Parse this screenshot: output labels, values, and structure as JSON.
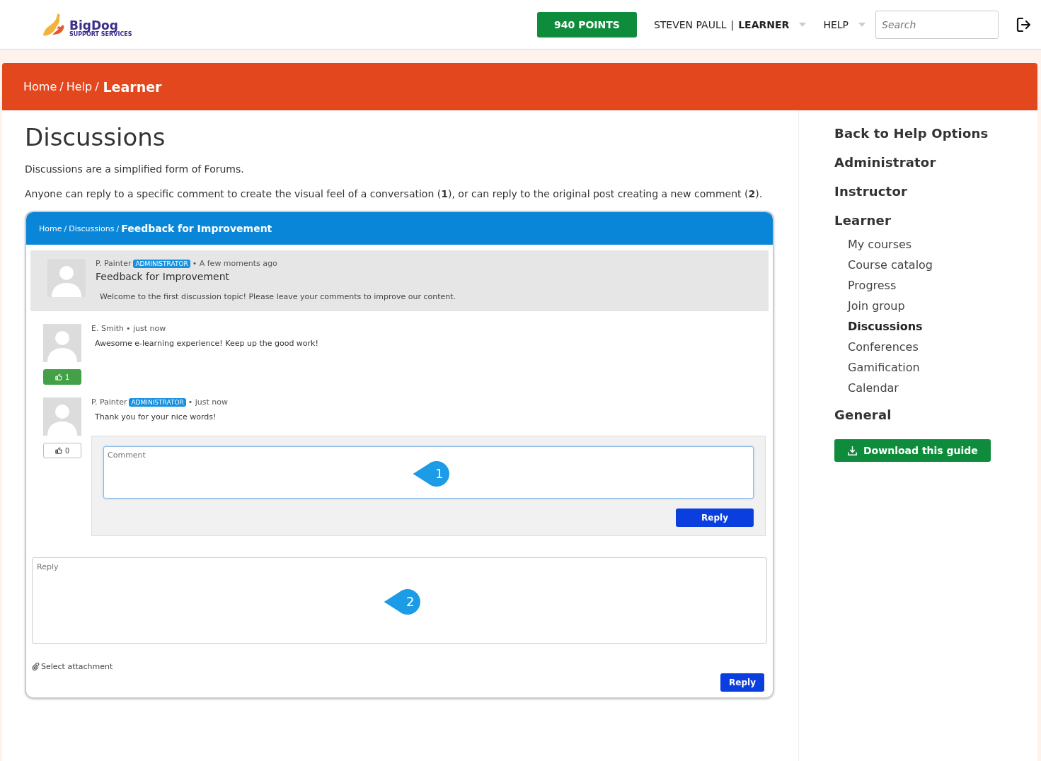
{
  "header": {
    "logo": {
      "name": "BigDog",
      "tagline": "SUPPORT SERVICES"
    },
    "points": "940 POINTS",
    "user": {
      "name": "STEVEN PAULL",
      "separator": "|",
      "role": "LEARNER"
    },
    "help": "HELP",
    "search": {
      "placeholder": "Search"
    }
  },
  "breadcrumb": {
    "separator": "/",
    "items": [
      "Home",
      "Help"
    ],
    "current": "Learner"
  },
  "main": {
    "title": "Discussions",
    "paragraphs": [
      "Discussions are a simplified form of Forums.",
      "Anyone can reply to a specific comment to create the visual feel of a conversation (**1**), or can reply to the original post creating a new comment (**2**)."
    ],
    "screenshot": {
      "breadcrumb": {
        "separator": "/",
        "items": [
          "Home",
          "Discussions"
        ],
        "current": "Feedback for Improvement"
      },
      "post": {
        "author": "P. Painter",
        "badge": "ADMINISTRATOR",
        "time": "• A few moments ago",
        "title": "Feedback for Improvement",
        "body": "Welcome to the first discussion topic! Please leave your comments to improve our content."
      },
      "comments": [
        {
          "author": "E. Smith",
          "time": "• just now",
          "body": "Awesome e-learning experience! Keep up the good work!",
          "likes": "1",
          "liked": true
        },
        {
          "author": "P. Painter",
          "badge": "ADMINISTRATOR",
          "time": "• just now",
          "body": "Thank you for your nice words!",
          "likes": "0",
          "liked": false,
          "reply_box": {
            "placeholder": "Comment",
            "marker": "1",
            "button": "Reply"
          }
        }
      ],
      "reply_field": {
        "placeholder": "Reply",
        "marker": "2"
      },
      "attachment": "Select attachment",
      "reply_button": "Reply"
    }
  },
  "sidebar": {
    "items": [
      {
        "label": "Back to Help Options",
        "selected": false
      },
      {
        "label": "Administrator",
        "selected": false
      },
      {
        "label": "Instructor",
        "selected": false
      },
      {
        "label": "Learner",
        "selected": false,
        "children": [
          {
            "label": "My courses",
            "selected": false
          },
          {
            "label": "Course catalog",
            "selected": false
          },
          {
            "label": "Progress",
            "selected": false
          },
          {
            "label": "Join group",
            "selected": false
          },
          {
            "label": "Discussions",
            "selected": true
          },
          {
            "label": "Conferences",
            "selected": false
          },
          {
            "label": "Gamification",
            "selected": false
          },
          {
            "label": "Calendar",
            "selected": false
          }
        ]
      },
      {
        "label": "General",
        "selected": false
      }
    ],
    "download": "Download this guide"
  }
}
